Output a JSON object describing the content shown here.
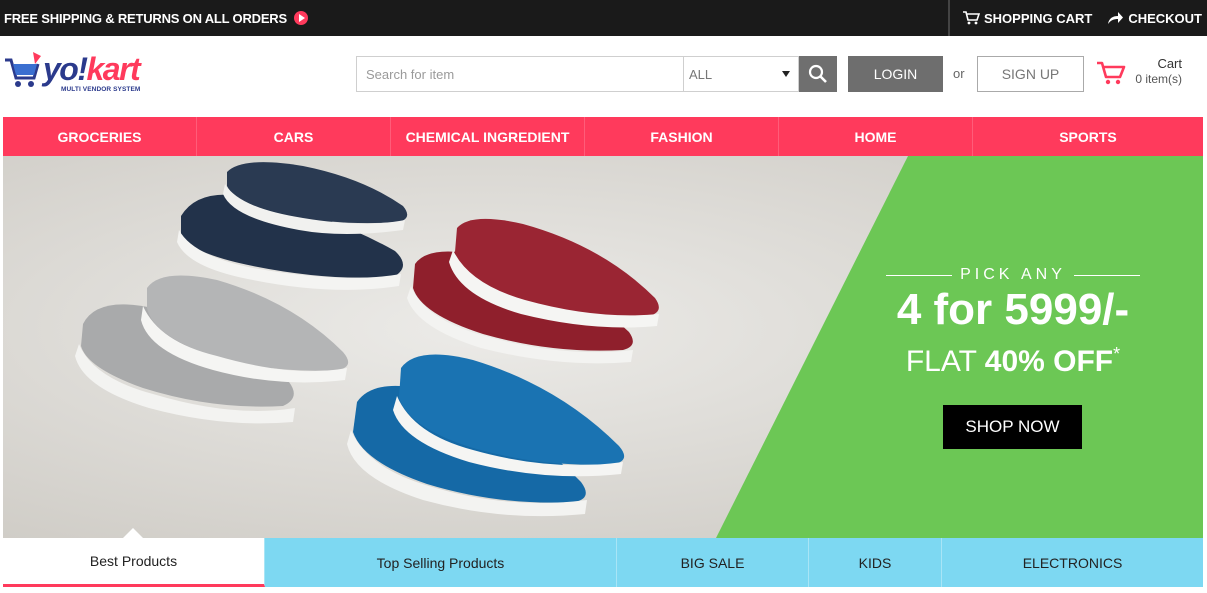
{
  "topbar": {
    "promo_text": "FREE SHIPPING & RETURNS ON ALL ORDERS",
    "shopping_cart_label": "SHOPPING CART",
    "checkout_label": "CHECKOUT"
  },
  "logo": {
    "brand_prefix": "yo!",
    "brand_suffix": "kart",
    "tagline": "MULTI VENDOR SYSTEM"
  },
  "search": {
    "placeholder": "Search for item",
    "value": "",
    "category_selected": "ALL"
  },
  "auth": {
    "login_label": "LOGIN",
    "or_text": "or",
    "signup_label": "SIGN UP"
  },
  "cart": {
    "label": "Cart",
    "count_text": "0 item(s)"
  },
  "categories": [
    "GROCERIES",
    "CARS",
    "CHEMICAL INGREDIENT",
    "FASHION",
    "HOME",
    "SPORTS"
  ],
  "banner": {
    "pick_any": "PICK ANY",
    "price_qty": "4 for ",
    "price_value": "5999/-",
    "flat_word": "FLAT ",
    "discount": "40% OFF",
    "discount_mark": "*",
    "cta_label": "SHOP NOW"
  },
  "tabs": [
    "Best Products",
    "Top Selling Products",
    "BIG SALE",
    "KIDS",
    "ELECTRONICS"
  ],
  "colors": {
    "accent": "#ff3a5c",
    "tab_bg": "#7dd8f2",
    "banner_green": "#6cc755",
    "dark": "#1a1a1a"
  }
}
